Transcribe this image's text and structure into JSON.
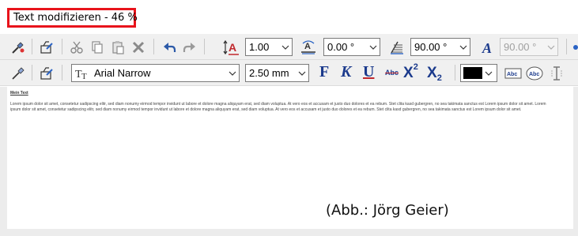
{
  "window": {
    "title": "Text modifizieren - 46 %"
  },
  "toolbar1": {
    "line_spacing_value": "1.00",
    "rotation_value": "0.00 °",
    "angle_value": "90.00 °",
    "slant_value": "90.00 °"
  },
  "toolbar2": {
    "font_name": "Arial Narrow",
    "font_size": "2.50 mm",
    "bold_label": "F",
    "italic_label": "K",
    "underline_label": "U",
    "strike_label": "Abc",
    "superscript_label": "X",
    "superscript_mark": "2",
    "subscript_label": "X",
    "subscript_mark": "2",
    "text_color": "#000000"
  },
  "document": {
    "heading": "Mein Text",
    "body": "Lorem ipsum dolor sit amet, consetetur sadipscing elitr, sed diam nonumy eirmod tempor invidunt ut labore et dolore magna aliquyam erat, sed diam voluptua. At vero eos et accusam et justo duo dolores et ea rebum. Stet clita kasd gubergren, no sea takimata sanctus est Lorem ipsum dolor sit amet. Lorem ipsum dolor sit amet, consetetur sadipscing elitr, sed diam nonumy eirmod tempor invidunt ut labore et dolore magna aliquyam erat, sed diam voluptua. At vero eos et accusam et justo duo dolores et ea rebum. Stet clita kasd gubergren, no sea takimata sanctus est Lorem ipsum dolor sit amet."
  },
  "caption": "(Abb.: Jörg Geier)",
  "colors": {
    "title_border": "#e8131b",
    "format_blue": "#1b3a8c",
    "text_size_red": "#c0282d"
  }
}
